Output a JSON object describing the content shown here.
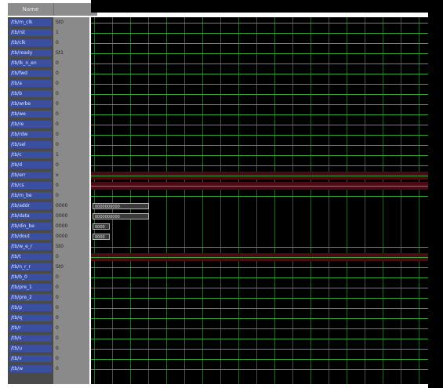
{
  "header": {
    "name_label": "Name",
    "value_label": ""
  },
  "colors": {
    "name_bg": "#3a4fa0",
    "value_bg": "#8a8a8a",
    "wave_bg": "#000000",
    "trace": "#39a83a",
    "grid": "#2d5e2d",
    "red_band": "#4a0b14",
    "bus_box": "#3a3a3a"
  },
  "signals": [
    {
      "name": "/tb/m_clk",
      "value": "St0",
      "type": "wire"
    },
    {
      "name": "/tb/rst",
      "value": "1",
      "type": "wire"
    },
    {
      "name": "/tb/clk",
      "value": "0",
      "type": "wire"
    },
    {
      "name": "/tb/ready",
      "value": "St1",
      "type": "wire"
    },
    {
      "name": "/tb/lk_n_en",
      "value": "0",
      "type": "wire"
    },
    {
      "name": "/tb/fwd",
      "value": "0",
      "type": "wire"
    },
    {
      "name": "/tb/a",
      "value": "0",
      "type": "wire"
    },
    {
      "name": "/tb/b",
      "value": "0",
      "type": "wire"
    },
    {
      "name": "/tb/wrbe",
      "value": "0",
      "type": "wire"
    },
    {
      "name": "/tb/we",
      "value": "0",
      "type": "wire"
    },
    {
      "name": "/tb/re",
      "value": "0",
      "type": "wire"
    },
    {
      "name": "/tb/rdw",
      "value": "0",
      "type": "wire"
    },
    {
      "name": "/tb/sel",
      "value": "0",
      "type": "wire"
    },
    {
      "name": "/tb/c",
      "value": "1",
      "type": "wire"
    },
    {
      "name": "/tb/d",
      "value": "0",
      "type": "wire"
    },
    {
      "name": "/tb/err",
      "value": "x",
      "type": "red"
    },
    {
      "name": "/tb/cs",
      "value": "0",
      "type": "red"
    },
    {
      "name": "/tb/m_be",
      "value": "0",
      "type": "wire"
    },
    {
      "name": "/tb/addr",
      "value": "0000",
      "type": "bus",
      "bus": "0000000000"
    },
    {
      "name": "/tb/data",
      "value": "0000",
      "type": "bus",
      "bus": "0000000000"
    },
    {
      "name": "/tb/din_be",
      "value": "0000",
      "type": "bus2",
      "bus": "0000"
    },
    {
      "name": "/tb/dout",
      "value": "0000",
      "type": "bus2",
      "bus": "0000"
    },
    {
      "name": "/tb/w_e_r",
      "value": "St0",
      "type": "wire"
    },
    {
      "name": "/tb/t",
      "value": "0",
      "type": "red"
    },
    {
      "name": "/tb/n_r_r",
      "value": "St0",
      "type": "wire"
    },
    {
      "name": "/tb/b_0",
      "value": "0",
      "type": "wire"
    },
    {
      "name": "/tb/pre_1",
      "value": "0",
      "type": "wire"
    },
    {
      "name": "/tb/pre_2",
      "value": "0",
      "type": "wire"
    },
    {
      "name": "/tb/p",
      "value": "0",
      "type": "wire"
    },
    {
      "name": "/tb/q",
      "value": "0",
      "type": "wire"
    },
    {
      "name": "/tb/r",
      "value": "0",
      "type": "wire"
    },
    {
      "name": "/tb/s",
      "value": "0",
      "type": "wire"
    },
    {
      "name": "/tb/u",
      "value": "0",
      "type": "wire"
    },
    {
      "name": "/tb/v",
      "value": "0",
      "type": "wire"
    },
    {
      "name": "/tb/w",
      "value": "0",
      "type": "wire"
    }
  ]
}
